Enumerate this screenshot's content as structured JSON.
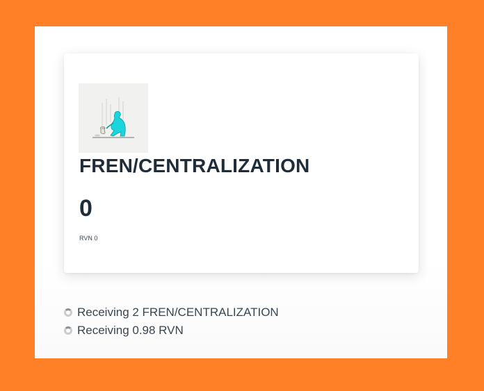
{
  "asset": {
    "name": "FREN/CENTRALIZATION",
    "balance": "0",
    "rvn_line": "RVN 0",
    "image_icon": "crouching-figure-illustration"
  },
  "status": [
    {
      "icon": "loading-spinner-icon",
      "text": "Receiving 2 FREN/CENTRALIZATION"
    },
    {
      "icon": "loading-spinner-icon",
      "text": "Receiving 0.98 RVN"
    }
  ],
  "colors": {
    "frame": "#ff8027",
    "title": "#1f2d3a",
    "illustration_accent": "#19d6de"
  }
}
